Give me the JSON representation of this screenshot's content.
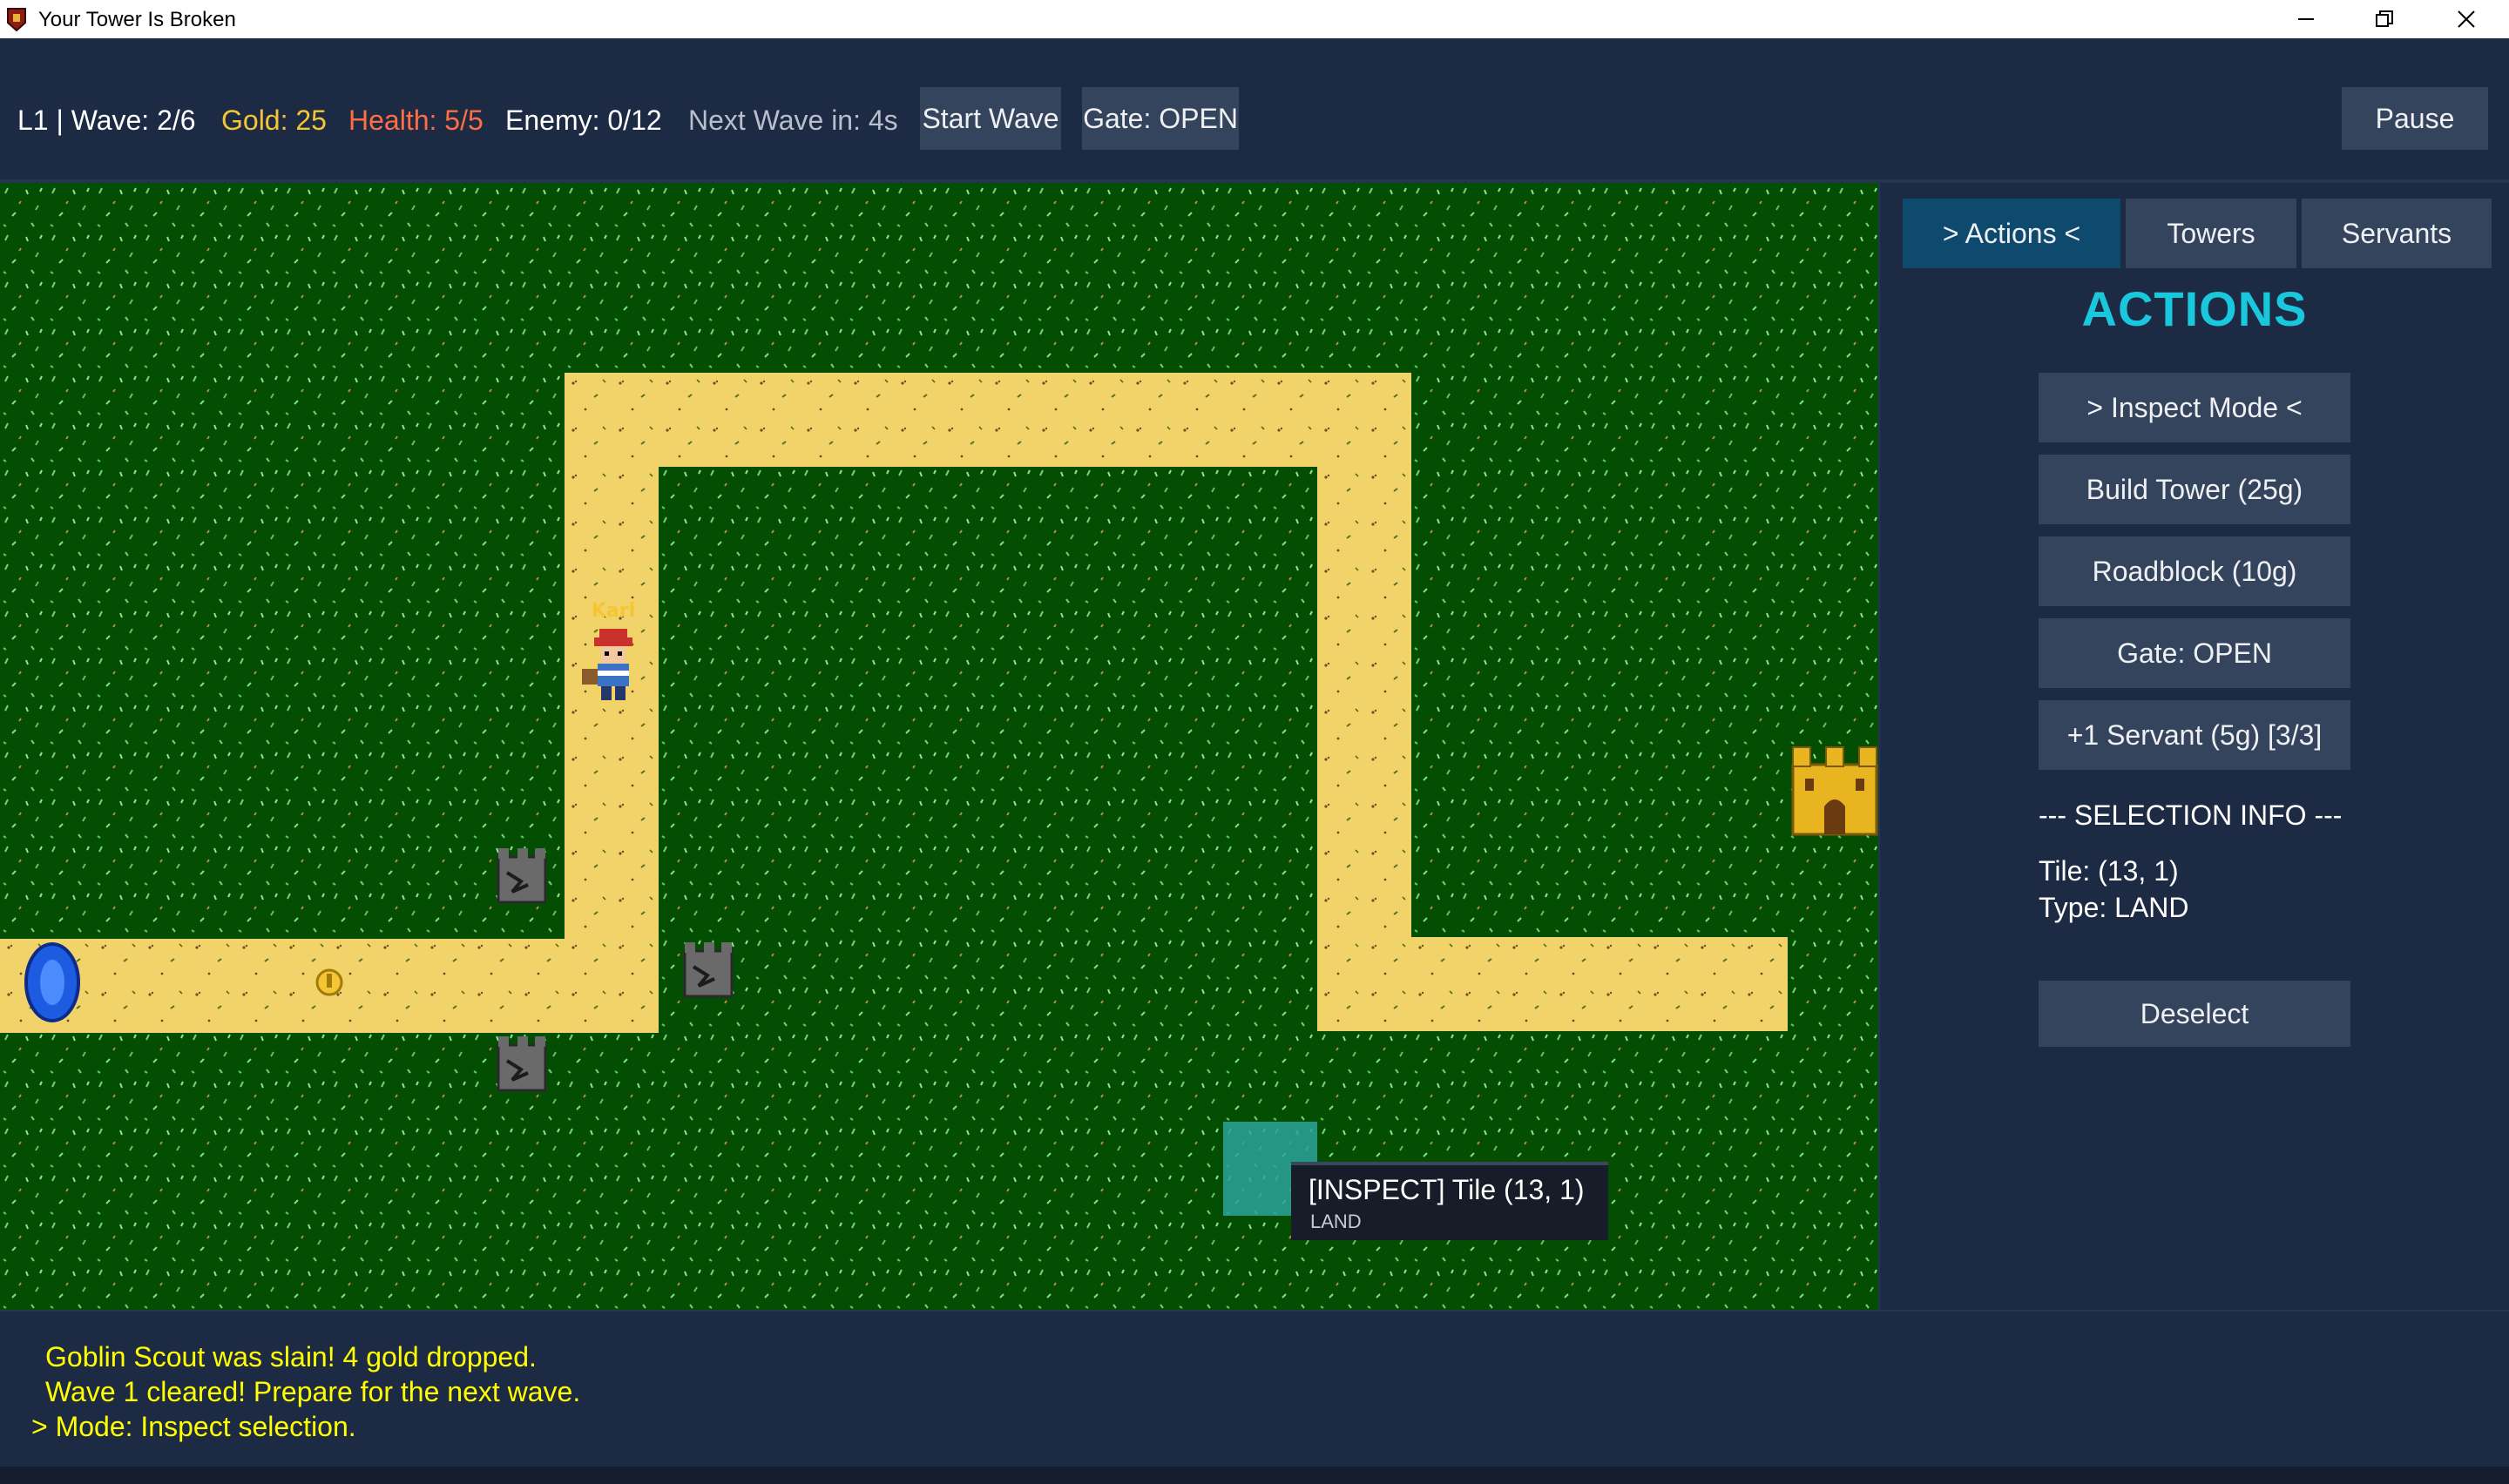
{
  "window": {
    "title": "Your Tower Is Broken",
    "controls": [
      "minimize",
      "restore",
      "close"
    ]
  },
  "hud": {
    "level_wave": "L1 | Wave: 2/6",
    "gold": "Gold: 25",
    "health": "Health: 5/5",
    "enemy": "Enemy: 0/12",
    "next_wave": "Next Wave in: 4s",
    "start_wave_label": "Start Wave",
    "gate_label": "Gate: OPEN",
    "pause_label": "Pause",
    "colors": {
      "gold": "#f4c534",
      "health": "#ff6d43",
      "next_wave": "#b9bfca",
      "default": "#ffffff"
    }
  },
  "map": {
    "grass_color": "#044e04",
    "path_color": "#f1d36a",
    "servant_name": "Karl",
    "selection_color": "#2aa39a",
    "icons": {
      "spawn": "blue-portal-icon",
      "coin": "gold-coin-icon",
      "servant": "servant-sprite",
      "castle": "castle-icon",
      "towers": "broken-tower-icon"
    }
  },
  "tooltip": {
    "title": "[INSPECT] Tile (13, 1)",
    "subtitle": "LAND"
  },
  "panel": {
    "tabs": [
      "> Actions <",
      "Towers",
      "Servants"
    ],
    "active_tab": 0,
    "heading": "ACTIONS",
    "actions": [
      "> Inspect Mode <",
      "Build Tower (25g)",
      "Roadblock (10g)",
      "Gate: OPEN",
      "+1 Servant (5g) [3/3]"
    ],
    "selection_header": "--- SELECTION INFO ---",
    "tile_info": "Tile: (13, 1)",
    "type_info": "Type: LAND",
    "deselect_label": "Deselect",
    "heading_color": "#19c8dc"
  },
  "log": {
    "lines": [
      "Goblin Scout was slain! 4 gold dropped.",
      "Wave 1 cleared! Prepare for the next wave.",
      "> Mode: Inspect selection."
    ],
    "color": "#ffff00"
  }
}
